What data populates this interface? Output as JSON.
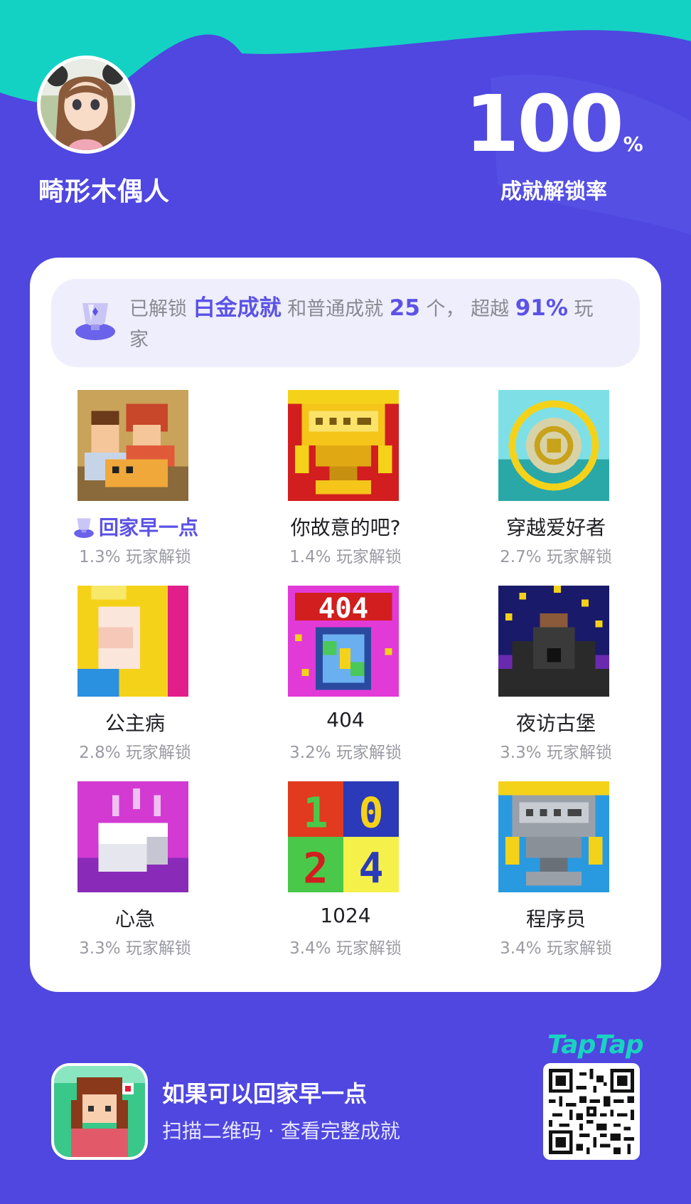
{
  "profile": {
    "username": "畸形木偶人",
    "unlock_rate": "100",
    "unlock_rate_unit": "%",
    "unlock_rate_label": "成就解锁率"
  },
  "summary": {
    "prefix": "已解锁",
    "platinum": "白金成就",
    "middle": "和普通成就",
    "count": "25",
    "count_suffix": "个，",
    "beat_prefix": "超越",
    "beat_percent": "91%",
    "suffix": "玩家"
  },
  "achievements": [
    {
      "name": "回家早一点",
      "percent": "1.3% 玩家解锁",
      "special": true,
      "icon": "family-cat-icon"
    },
    {
      "name": "你故意的吧?",
      "percent": "1.4% 玩家解锁",
      "special": false,
      "icon": "fail-trophy-gold-icon"
    },
    {
      "name": "穿越爱好者",
      "percent": "2.7% 玩家解锁",
      "special": false,
      "icon": "portal-icon"
    },
    {
      "name": "公主病",
      "percent": "2.8% 玩家解锁",
      "special": false,
      "icon": "princess-icon"
    },
    {
      "name": "404",
      "percent": "3.2% 玩家解锁",
      "special": false,
      "icon": "404-icon"
    },
    {
      "name": "夜访古堡",
      "percent": "3.3% 玩家解锁",
      "special": false,
      "icon": "castle-icon"
    },
    {
      "name": "心急",
      "percent": "3.3% 玩家解锁",
      "special": false,
      "icon": "tofu-icon"
    },
    {
      "name": "1024",
      "percent": "3.4% 玩家解锁",
      "special": false,
      "icon": "1024-icon"
    },
    {
      "name": "程序员",
      "percent": "3.4% 玩家解锁",
      "special": false,
      "icon": "fail-trophy-silver-icon"
    }
  ],
  "footer": {
    "game_title": "如果可以回家早一点",
    "subtitle": "扫描二维码 · 查看完整成就",
    "brand": "TapTap"
  },
  "colors": {
    "background": "#4f47e0",
    "accent": "#5b52e6",
    "teal": "#19d3c0"
  }
}
